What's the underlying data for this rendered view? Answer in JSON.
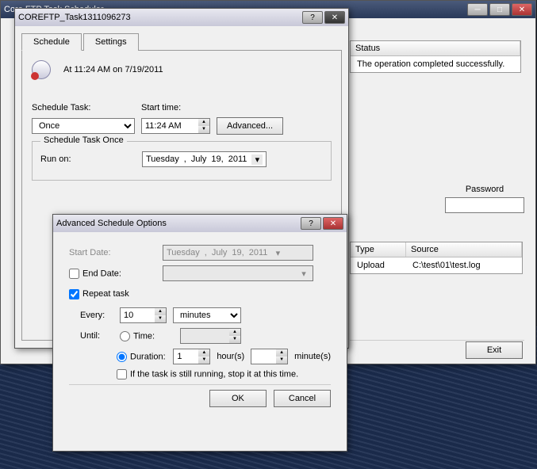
{
  "parent": {
    "title": "Core FTP Task Scheduler",
    "cols": {
      "status": "Status"
    },
    "msg": "The operation completed successfully.",
    "password_label": "Password",
    "cols2": {
      "type": "Type",
      "source": "Source"
    },
    "row": {
      "type": "Upload",
      "source": "C:\\test\\01\\test.log"
    },
    "exit": "Exit"
  },
  "sched": {
    "title": "COREFTP_Task1311096273",
    "tabs": {
      "schedule": "Schedule",
      "settings": "Settings"
    },
    "summary": "At 11:24 AM on 7/19/2011",
    "schedule_task_label": "Schedule Task:",
    "schedule_task_value": "Once",
    "start_time_label": "Start time:",
    "start_time_value": "11:24 AM",
    "advanced": "Advanced...",
    "once_group": "Schedule Task Once",
    "run_on": "Run on:",
    "date": {
      "wday": "Tuesday",
      "month": "July",
      "day": "19,",
      "year": "2011"
    }
  },
  "adv": {
    "title": "Advanced Schedule Options",
    "start_date": "Start Date:",
    "start_date_val": {
      "wday": "Tuesday",
      "month": "July",
      "day": "19,",
      "year": "2011"
    },
    "end_date": "End Date:",
    "repeat": "Repeat task",
    "every": "Every:",
    "every_val": "10",
    "every_unit": "minutes",
    "until": "Until:",
    "time": "Time:",
    "duration": "Duration:",
    "dur_h": "1",
    "hours": "hour(s)",
    "dur_m": "",
    "minutes": "minute(s)",
    "stop": "If the task is still running, stop it at this time.",
    "ok": "OK",
    "cancel": "Cancel"
  }
}
